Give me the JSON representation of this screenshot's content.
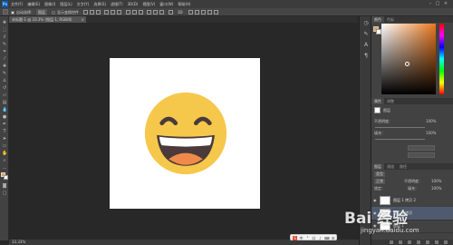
{
  "app": {
    "logo_text": "Ps"
  },
  "menu": [
    "文件(F)",
    "编辑(E)",
    "图像(I)",
    "图层(L)",
    "文字(Y)",
    "选择(S)",
    "滤镜(T)",
    "3D(D)",
    "视图(V)",
    "窗口(W)",
    "帮助(H)"
  ],
  "options_bar": {
    "auto_select_label": "自动选择：",
    "auto_select_value": "图层",
    "show_transform_label": "显示变换控件"
  },
  "document_tab": {
    "title": "未标题-1 @ 33.3% (图层 1, RGB/8)",
    "close": "×"
  },
  "status_bar": {
    "zoom": "33.33%"
  },
  "panels": {
    "color": {
      "tabs": [
        "颜色",
        "色板"
      ],
      "foreground_color": "#e9a24b",
      "background_color": "#ffffff"
    },
    "properties": {
      "tabs": [
        "属性",
        "调整"
      ],
      "kind": "图层",
      "opacity_label": "不透明度：",
      "opacity_value": "100%",
      "fill_label": "填充：",
      "fill_value": "100%"
    },
    "layers": {
      "tabs": [
        "图层",
        "通道",
        "路径"
      ],
      "filter_label": "类型",
      "blend_mode": "正常",
      "opacity_label": "不透明度：",
      "opacity_value": "100%",
      "lock_label": "锁定：",
      "fill_label": "填充：",
      "fill_value": "100%",
      "items": [
        {
          "name": "图层 1 拷贝 2",
          "selected": false
        },
        {
          "name": "图层 1 拷贝",
          "selected": true
        },
        {
          "name": "图层 1",
          "selected": false
        }
      ]
    }
  },
  "colors": {
    "smiley_face": "#f5c84b",
    "mouth": "#4a3a3a",
    "teeth": "#ffffff",
    "tongue": "#f08a4b"
  },
  "watermark": {
    "main": "Bai 经验",
    "sub": "jingyan.baidu.com"
  }
}
